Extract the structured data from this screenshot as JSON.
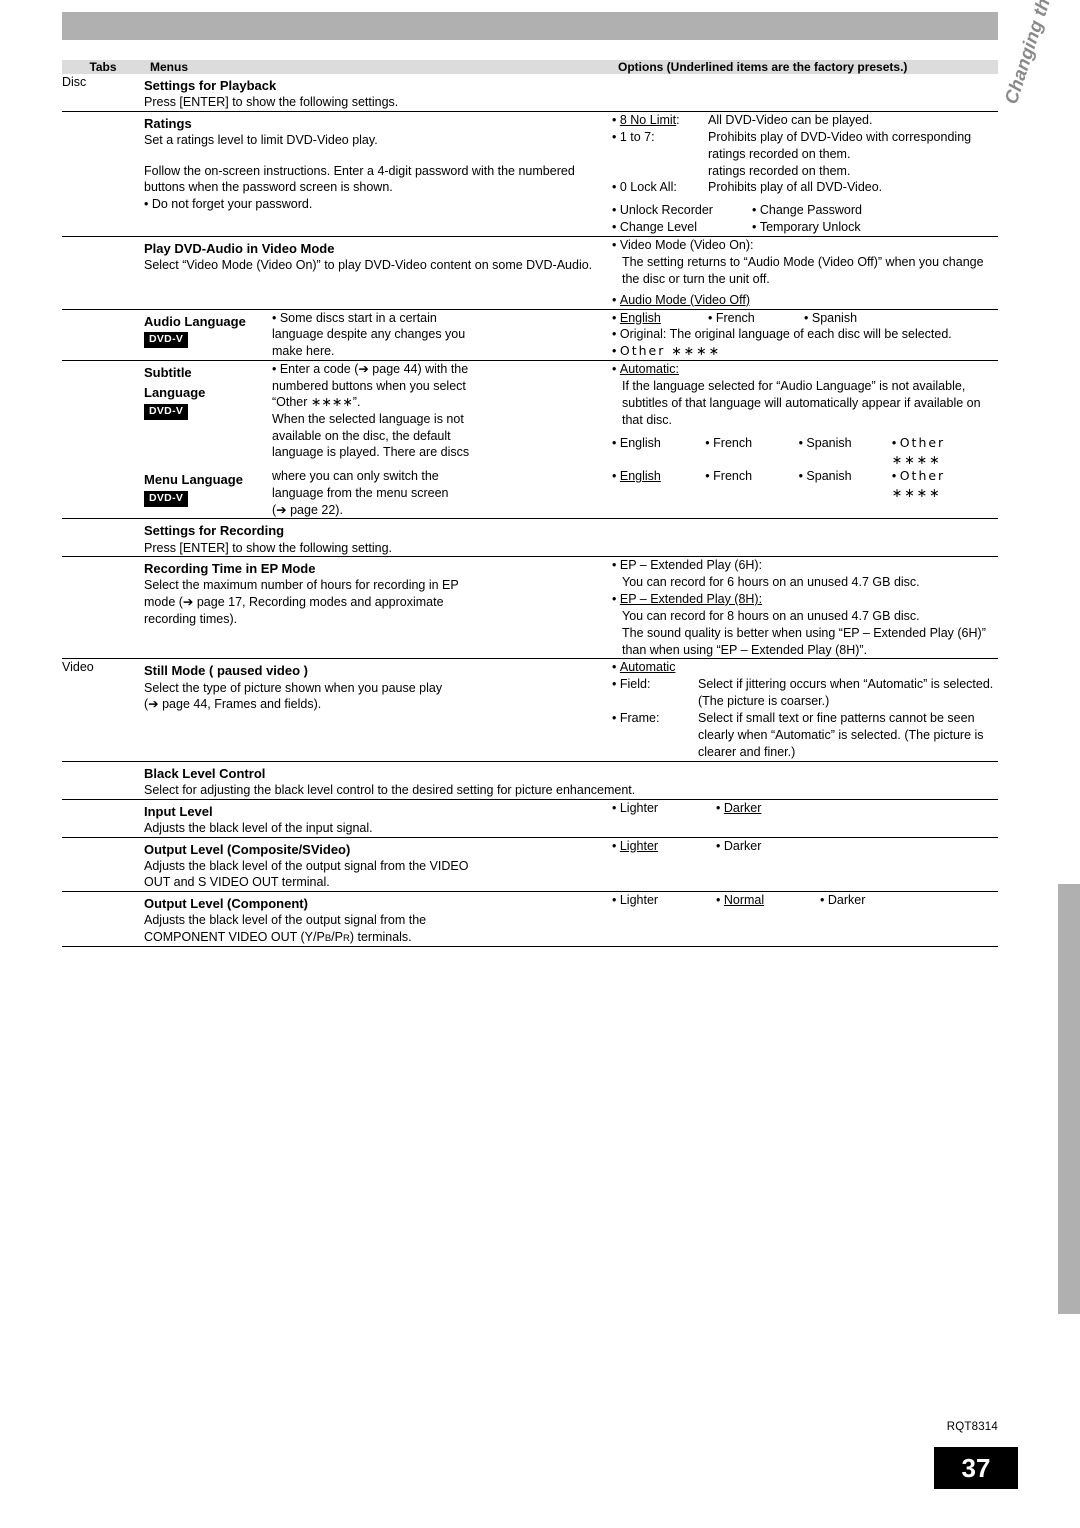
{
  "vertical_title": "Changing the unit’s settings",
  "headers": {
    "tabs": "Tabs",
    "menus": "Menus",
    "options": "Options (Underlined items are the factory presets.)"
  },
  "tabs": {
    "disc": "Disc",
    "video": "Video"
  },
  "sections": {
    "settings_for_playback": {
      "title": "Settings for Playback",
      "desc": "Press [ENTER] to show the following settings."
    },
    "ratings": {
      "title": "Ratings",
      "desc1": "Set a ratings level to limit DVD-Video play.",
      "desc2": "Follow the on-screen instructions. Enter a 4-digit password with the numbered buttons when the password screen is shown.",
      "desc3": "• Do not forget your password.",
      "opt1_label": "8 No Limit",
      "opt1_text": "All DVD-Video can be played.",
      "opt2_label": "1 to 7",
      "opt2_text": "Prohibits play of DVD-Video with corresponding ratings recorded on them.",
      "opt3_label": "0 Lock All",
      "opt3_text": "Prohibits play of all DVD-Video.",
      "opt4": "Unlock Recorder",
      "opt5": "Change Password",
      "opt6": "Change Level",
      "opt7": "Temporary Unlock"
    },
    "play_dvd_audio": {
      "title": "Play DVD-Audio in Video Mode",
      "desc": "Select “Video Mode (Video On)” to play DVD-Video content on some DVD-Audio.",
      "opt1": "Video Mode (Video On):",
      "opt1_note": "The setting returns to “Audio Mode (Video Off)” when you change the disc or turn the unit off.",
      "opt2": "Audio Mode (Video Off)"
    },
    "audio_language": {
      "title": "Audio Language",
      "badge": "DVD-V",
      "opt_english": "English",
      "opt_french": "French",
      "opt_spanish": "Spanish",
      "opt_original": "Original: The original language of each disc will be selected.",
      "opt_other": "Other ∗∗∗∗"
    },
    "subtitle_language": {
      "title_line1": "Subtitle",
      "title_line2": "Language",
      "badge": "DVD-V",
      "opt_automatic": "Automatic:",
      "opt_automatic_note": "If the language selected for “Audio Language” is not available, subtitles of that language will automatically appear if available on that disc.",
      "opt_english": "English",
      "opt_french": "French",
      "opt_spanish": "Spanish",
      "opt_other": "Other ∗∗∗∗"
    },
    "menu_language": {
      "title": "Menu Language",
      "badge": "DVD-V",
      "opt_english": "English",
      "opt_french": "French",
      "opt_spanish": "Spanish",
      "opt_other": "Other ∗∗∗∗"
    },
    "language_shared_text": {
      "l1": "• Some discs start in a certain",
      "l2": "language despite any changes you",
      "l3": "make here.",
      "l4": "• Enter a code (➔ page 44) with the",
      "l5": "numbered buttons when you select",
      "l6": "“Other ∗∗∗∗”.",
      "l7": "When the selected language is not",
      "l8": "available on the disc, the default",
      "l9": "language is played. There are discs",
      "l10": "where you can only switch the",
      "l11": "language from the menu screen",
      "l12": "(➔ page 22)."
    },
    "settings_for_recording": {
      "title": "Settings for Recording",
      "desc": "Press [ENTER] to show the following setting."
    },
    "recording_time_ep": {
      "title": "Recording Time in EP Mode",
      "desc1": "Select the maximum number of hours for recording in EP",
      "desc2": "mode (➔ page 17, Recording modes and approximate",
      "desc3": "recording times).",
      "opt1": "EP – Extended Play (6H):",
      "opt1_note": "You can record for 6 hours on an unused 4.7 GB disc.",
      "opt2": "EP – Extended Play (8H):",
      "opt2_note": "You can record for 8 hours on an unused 4.7 GB disc.",
      "opt_note3": "The sound quality is better when using “EP – Extended Play (6H)” than when using “EP – Extended Play (8H)”."
    },
    "still_mode": {
      "title": "Still Mode ( paused video )",
      "desc1": "Select the type of picture shown when you pause play",
      "desc2": "(➔ page 44, Frames and fields).",
      "opt1": "Automatic",
      "opt2_label": "Field:",
      "opt2_text": "Select if jittering occurs when “Automatic” is selected. (The picture is coarser.)",
      "opt3_label": "Frame:",
      "opt3_text": "Select if small text or fine patterns cannot be seen clearly when “Automatic” is selected. (The picture is clearer and finer.)"
    },
    "black_level_control": {
      "title": "Black Level Control",
      "desc": "Select for adjusting the black level control to the desired setting for picture enhancement."
    },
    "input_level": {
      "title": "Input Level",
      "desc": "Adjusts the black level of the input signal.",
      "opt1": "Lighter",
      "opt2": "Darker"
    },
    "output_level_composite": {
      "title": "Output Level (Composite/SVideo)",
      "desc1": "Adjusts the black level of the output signal from the VIDEO",
      "desc2": "OUT and S VIDEO OUT terminal.",
      "opt1": "Lighter",
      "opt2": "Darker"
    },
    "output_level_component": {
      "title": "Output Level (Component)",
      "desc1": "Adjusts the black level of the output signal from the",
      "desc2_pre": "COMPONENT VIDEO OUT (Y/P",
      "desc2_sub1": "B",
      "desc2_mid": "/P",
      "desc2_sub2": "R",
      "desc2_post": ") terminals.",
      "opt1": "Lighter",
      "opt2": "Normal",
      "opt3": "Darker"
    }
  },
  "footer": {
    "doc_code": "RQT8314",
    "page_number": "37"
  }
}
